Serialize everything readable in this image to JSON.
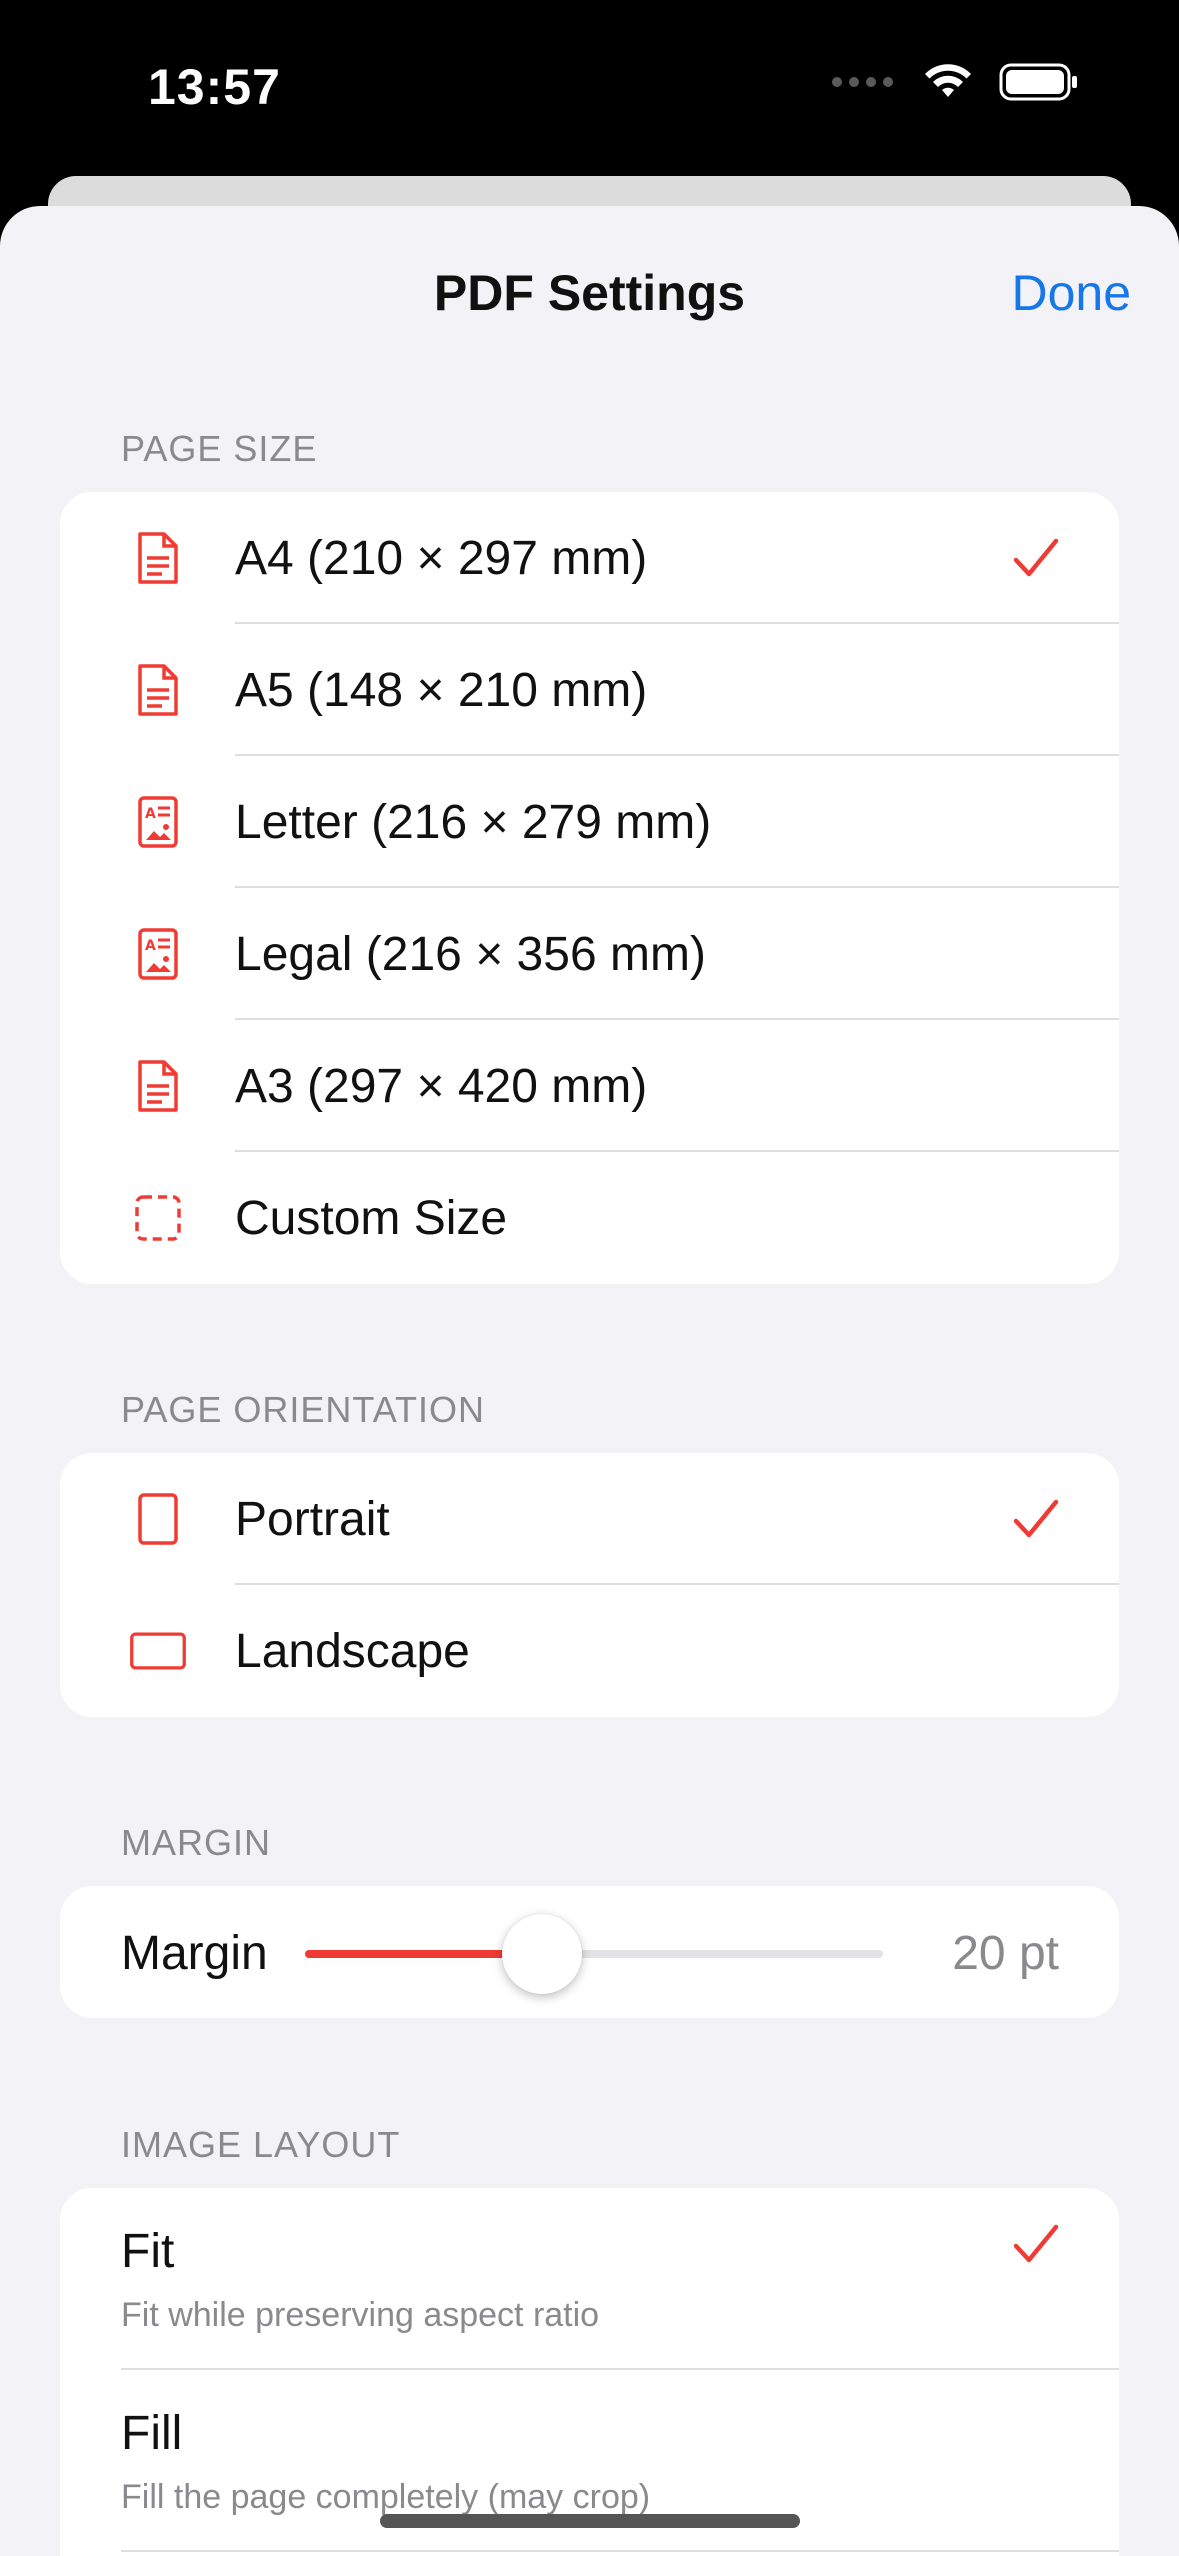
{
  "status_bar": {
    "time": "13:57"
  },
  "header": {
    "title": "PDF Settings",
    "done_label": "Done"
  },
  "page_size": {
    "header": "PAGE SIZE",
    "items": [
      {
        "label": "A4 (210 × 297 mm)",
        "icon": "doc-text-icon",
        "selected": true
      },
      {
        "label": "A5 (148 × 210 mm)",
        "icon": "doc-text-icon",
        "selected": false
      },
      {
        "label": "Letter (216 × 279 mm)",
        "icon": "doc-richtext-icon",
        "selected": false
      },
      {
        "label": "Legal (216 × 356 mm)",
        "icon": "doc-richtext-icon",
        "selected": false
      },
      {
        "label": "A3 (297 × 420 mm)",
        "icon": "doc-text-icon",
        "selected": false
      },
      {
        "label": "Custom Size",
        "icon": "dashed-square-icon",
        "selected": false
      }
    ]
  },
  "orientation": {
    "header": "PAGE ORIENTATION",
    "items": [
      {
        "label": "Portrait",
        "icon": "portrait-rect-icon",
        "selected": true
      },
      {
        "label": "Landscape",
        "icon": "landscape-rect-icon",
        "selected": false
      }
    ]
  },
  "margin": {
    "header": "MARGIN",
    "label": "Margin",
    "value_text": "20 pt",
    "slider_fraction": 0.41
  },
  "image_layout": {
    "header": "IMAGE LAYOUT",
    "items": [
      {
        "title": "Fit",
        "subtitle": "Fit while preserving aspect ratio",
        "selected": true
      },
      {
        "title": "Fill",
        "subtitle": "Fill the page completely (may crop)",
        "selected": false
      }
    ]
  },
  "colors": {
    "accent": "#ef3b33",
    "link": "#1677e8"
  }
}
